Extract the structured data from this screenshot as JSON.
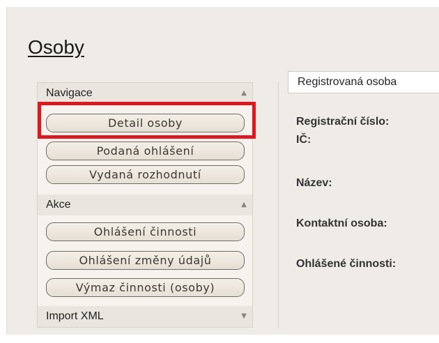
{
  "page": {
    "title": "Osoby"
  },
  "sidebar": {
    "navigace": {
      "header": "Navigace",
      "items": [
        {
          "label": "Detail osoby"
        },
        {
          "label": "Podaná ohlášení"
        },
        {
          "label": "Vydaná rozhodnutí"
        }
      ]
    },
    "akce": {
      "header": "Akce",
      "items": [
        {
          "label": "Ohlášení činnosti"
        },
        {
          "label": "Ohlášení změny údajů"
        },
        {
          "label": "Výmaz činnosti (osoby)"
        }
      ]
    },
    "import": {
      "header": "Import XML"
    }
  },
  "main": {
    "tab_label": "Registrovaná osoba",
    "fields": [
      {
        "label": "Registrační číslo:"
      },
      {
        "label": "IČ:"
      },
      {
        "label": "Název:"
      },
      {
        "label": "Kontaktní osoba:"
      },
      {
        "label": "Ohlášené činnosti:"
      }
    ]
  },
  "colors": {
    "highlight": "#e0161f",
    "page_bg": "#efebe6",
    "panel_bg": "#f6f3ee"
  }
}
